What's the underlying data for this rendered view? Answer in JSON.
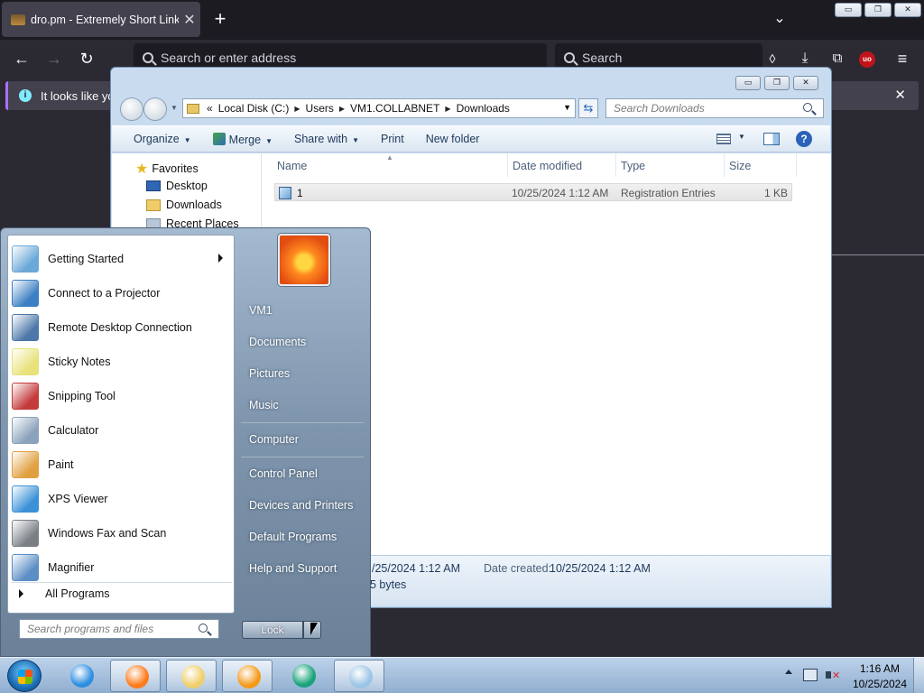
{
  "firefox": {
    "tab_title": "dro.pm - Extremely Short Links",
    "tab_close": "✕",
    "new_tab": "+",
    "tab_list": "⌄",
    "address_placeholder": "Search or enter address",
    "search_placeholder": "Search",
    "notification_text": "It looks like you",
    "notification_close": "✕",
    "nav": {
      "back": "←",
      "forward": "→",
      "reload": "↻"
    },
    "toolbar_icons": [
      "pocket-icon",
      "download-icon",
      "extensions-icon",
      "ublock-icon",
      "menu-icon"
    ],
    "caption": {
      "minimize": "▭",
      "restore": "❐",
      "close": "✕"
    }
  },
  "explorer": {
    "caption": {
      "minimize": "▭",
      "restore": "❐",
      "close": "✕"
    },
    "breadcrumb_prefix": "«",
    "breadcrumbs": [
      "Local Disk (C:)",
      "Users",
      "VM1.COLLABNET",
      "Downloads"
    ],
    "search_placeholder": "Search Downloads",
    "toolbar": {
      "organize": "Organize",
      "merge": "Merge",
      "share_with": "Share with",
      "print": "Print",
      "new_folder": "New folder"
    },
    "nav_pane": {
      "favorites": "Favorites",
      "items": [
        "Desktop",
        "Downloads",
        "Recent Places"
      ]
    },
    "columns": [
      "Name",
      "Date modified",
      "Type",
      "Size"
    ],
    "files": [
      {
        "name": "1",
        "date_modified": "10/25/2024 1:12 AM",
        "type": "Registration Entries",
        "size": "1 KB"
      }
    ],
    "details": {
      "modified_value": "/25/2024 1:12 AM",
      "date_created_label": "Date created:",
      "date_created_value": "10/25/2024 1:12 AM",
      "size_value": "5 bytes"
    }
  },
  "start_menu": {
    "programs": [
      {
        "label": "Getting Started",
        "has_submenu": true,
        "icon": "getting-started-icon",
        "color": "#6aa8d8"
      },
      {
        "label": "Connect to a Projector",
        "has_submenu": false,
        "icon": "projector-icon",
        "color": "#3c7fc2"
      },
      {
        "label": "Remote Desktop Connection",
        "has_submenu": false,
        "icon": "remote-desktop-icon",
        "color": "#4d77a8"
      },
      {
        "label": "Sticky Notes",
        "has_submenu": false,
        "icon": "sticky-notes-icon",
        "color": "#e8e27a"
      },
      {
        "label": "Snipping Tool",
        "has_submenu": false,
        "icon": "snipping-tool-icon",
        "color": "#c43b3b"
      },
      {
        "label": "Calculator",
        "has_submenu": false,
        "icon": "calculator-icon",
        "color": "#8aa2bb"
      },
      {
        "label": "Paint",
        "has_submenu": false,
        "icon": "paint-icon",
        "color": "#e0a040"
      },
      {
        "label": "XPS Viewer",
        "has_submenu": false,
        "icon": "xps-viewer-icon",
        "color": "#3b91d6"
      },
      {
        "label": "Windows Fax and Scan",
        "has_submenu": false,
        "icon": "fax-scan-icon",
        "color": "#7a7f86"
      },
      {
        "label": "Magnifier",
        "has_submenu": false,
        "icon": "magnifier-icon",
        "color": "#5b8ec4"
      }
    ],
    "all_programs": "All Programs",
    "search_placeholder": "Search programs and files",
    "right_links": [
      "VM1",
      "Documents",
      "Pictures",
      "Music",
      "Computer",
      "Control Panel",
      "Devices and Printers",
      "Default Programs",
      "Help and Support"
    ],
    "lock_label": "Lock"
  },
  "taskbar": {
    "apps": [
      {
        "name": "internet-explorer",
        "icon": "ie-icon",
        "color": "#2f8ee0"
      },
      {
        "name": "firefox",
        "icon": "firefox-icon",
        "color": "#ff7b1c"
      },
      {
        "name": "windows-explorer",
        "icon": "explorer-icon",
        "color": "#f0cf6a"
      },
      {
        "name": "media-player",
        "icon": "media-player-icon",
        "color": "#f49a1a"
      },
      {
        "name": "vpn-client",
        "icon": "vpn-client-icon",
        "color": "#1aa37a"
      },
      {
        "name": "notepad-app",
        "icon": "notepad-icon",
        "color": "#9cc4e4"
      }
    ],
    "clock_time": "1:16 AM",
    "clock_date": "10/25/2024"
  },
  "colors": {
    "firefox_dark": "#1c1b22",
    "firefox_toolbar": "#2b2a33",
    "win7_accent": "#1e395b",
    "taskbar": "#a8c2e0"
  }
}
